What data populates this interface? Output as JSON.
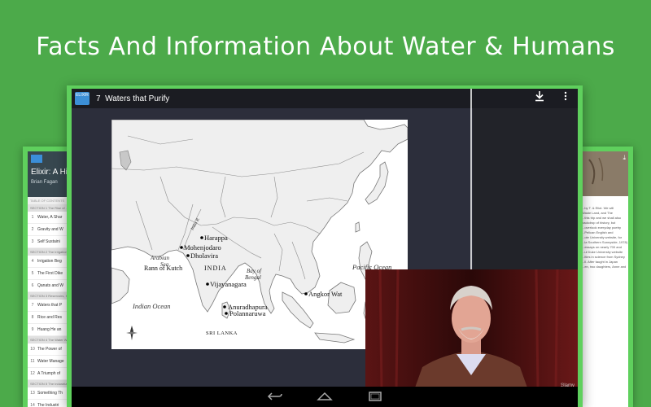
{
  "banner": {
    "headline": "Facts And Information About Water & Humans"
  },
  "left_device": {
    "book_title": "Elixir: A Histo",
    "author": "Brian Fagan",
    "toc_label": "TABLE OF CONTENTS",
    "sections": [
      {
        "label": "SECTION 1  The Rise of ...",
        "items": [
          {
            "num": "1",
            "label": "Water, A Shar"
          },
          {
            "num": "2",
            "label": "Gravity and W"
          },
          {
            "num": "3",
            "label": "Self Sustaini"
          }
        ]
      },
      {
        "label": "SECTION 2  The Irrigation ...",
        "items": [
          {
            "num": "4",
            "label": "Irrigation Beg"
          },
          {
            "num": "5",
            "label": "The First Dike"
          },
          {
            "num": "6",
            "label": "Qanats and W"
          }
        ]
      },
      {
        "label": "SECTION 3  Reservoirs, Ho...",
        "items": [
          {
            "num": "7",
            "label": "Waters that P"
          },
          {
            "num": "8",
            "label": "Rice and Res"
          },
          {
            "num": "9",
            "label": "Huang He an"
          }
        ]
      },
      {
        "label": "SECTION 4  The Water Wars",
        "items": [
          {
            "num": "10",
            "label": "The Power of"
          },
          {
            "num": "11",
            "label": "Water Manage"
          },
          {
            "num": "12",
            "label": "A Triumph of"
          }
        ]
      },
      {
        "label": "SECTION 5  The Industrial ...",
        "items": [
          {
            "num": "13",
            "label": "Something Th"
          },
          {
            "num": "14",
            "label": "The Industri"
          }
        ]
      }
    ]
  },
  "right_device": {
    "text_lines": [
      "...by T. & Eliot. We will",
      "Waste Land, and The",
      "...this trip and we shall also",
      "backdrop of history, but",
      "...overlook everyday poetry",
      "",
      "...Pelican English and",
      "...ote University website, for",
      "...ia Southern Sunnyside, 1978)",
      "",
      "...essays on nearly 700 and",
      "...ul Duke University website",
      "...ities in science from Sydney",
      "...ll. After taught in Japan",
      "...en, two daughters, Anne and"
    ]
  },
  "main_device": {
    "chapter_number": "7",
    "chapter_title": "Waters that Purify",
    "logo_text": "ELIXIR",
    "icons": [
      "download-icon",
      "overflow-menu-icon",
      "back-icon",
      "home-icon",
      "recents-icon"
    ],
    "map": {
      "labels": {
        "harappa": "Harappa",
        "mohenjodaro": "Mohenjodaro",
        "dholavira": "Dholavira",
        "arabian_sea": "Arabian\nSea",
        "rann_of_kutch": "Rann of Kutch",
        "india": "INDIA",
        "bay_of_bengal": "Bay of\nBengal",
        "vijayanagara": "Vijayanagara",
        "angkor_wat": "Angkor Wat",
        "indian_ocean": "Indian Ocean",
        "anuradhapura": "Anuradhapura",
        "polannaruwa": "Polannaruwa",
        "sri_lanka": "SRI LANKA",
        "pacific_ocean": "Pacific Ocean",
        "indus": "Indus R."
      }
    },
    "video": {
      "watermark": "ℬlamy"
    }
  }
}
